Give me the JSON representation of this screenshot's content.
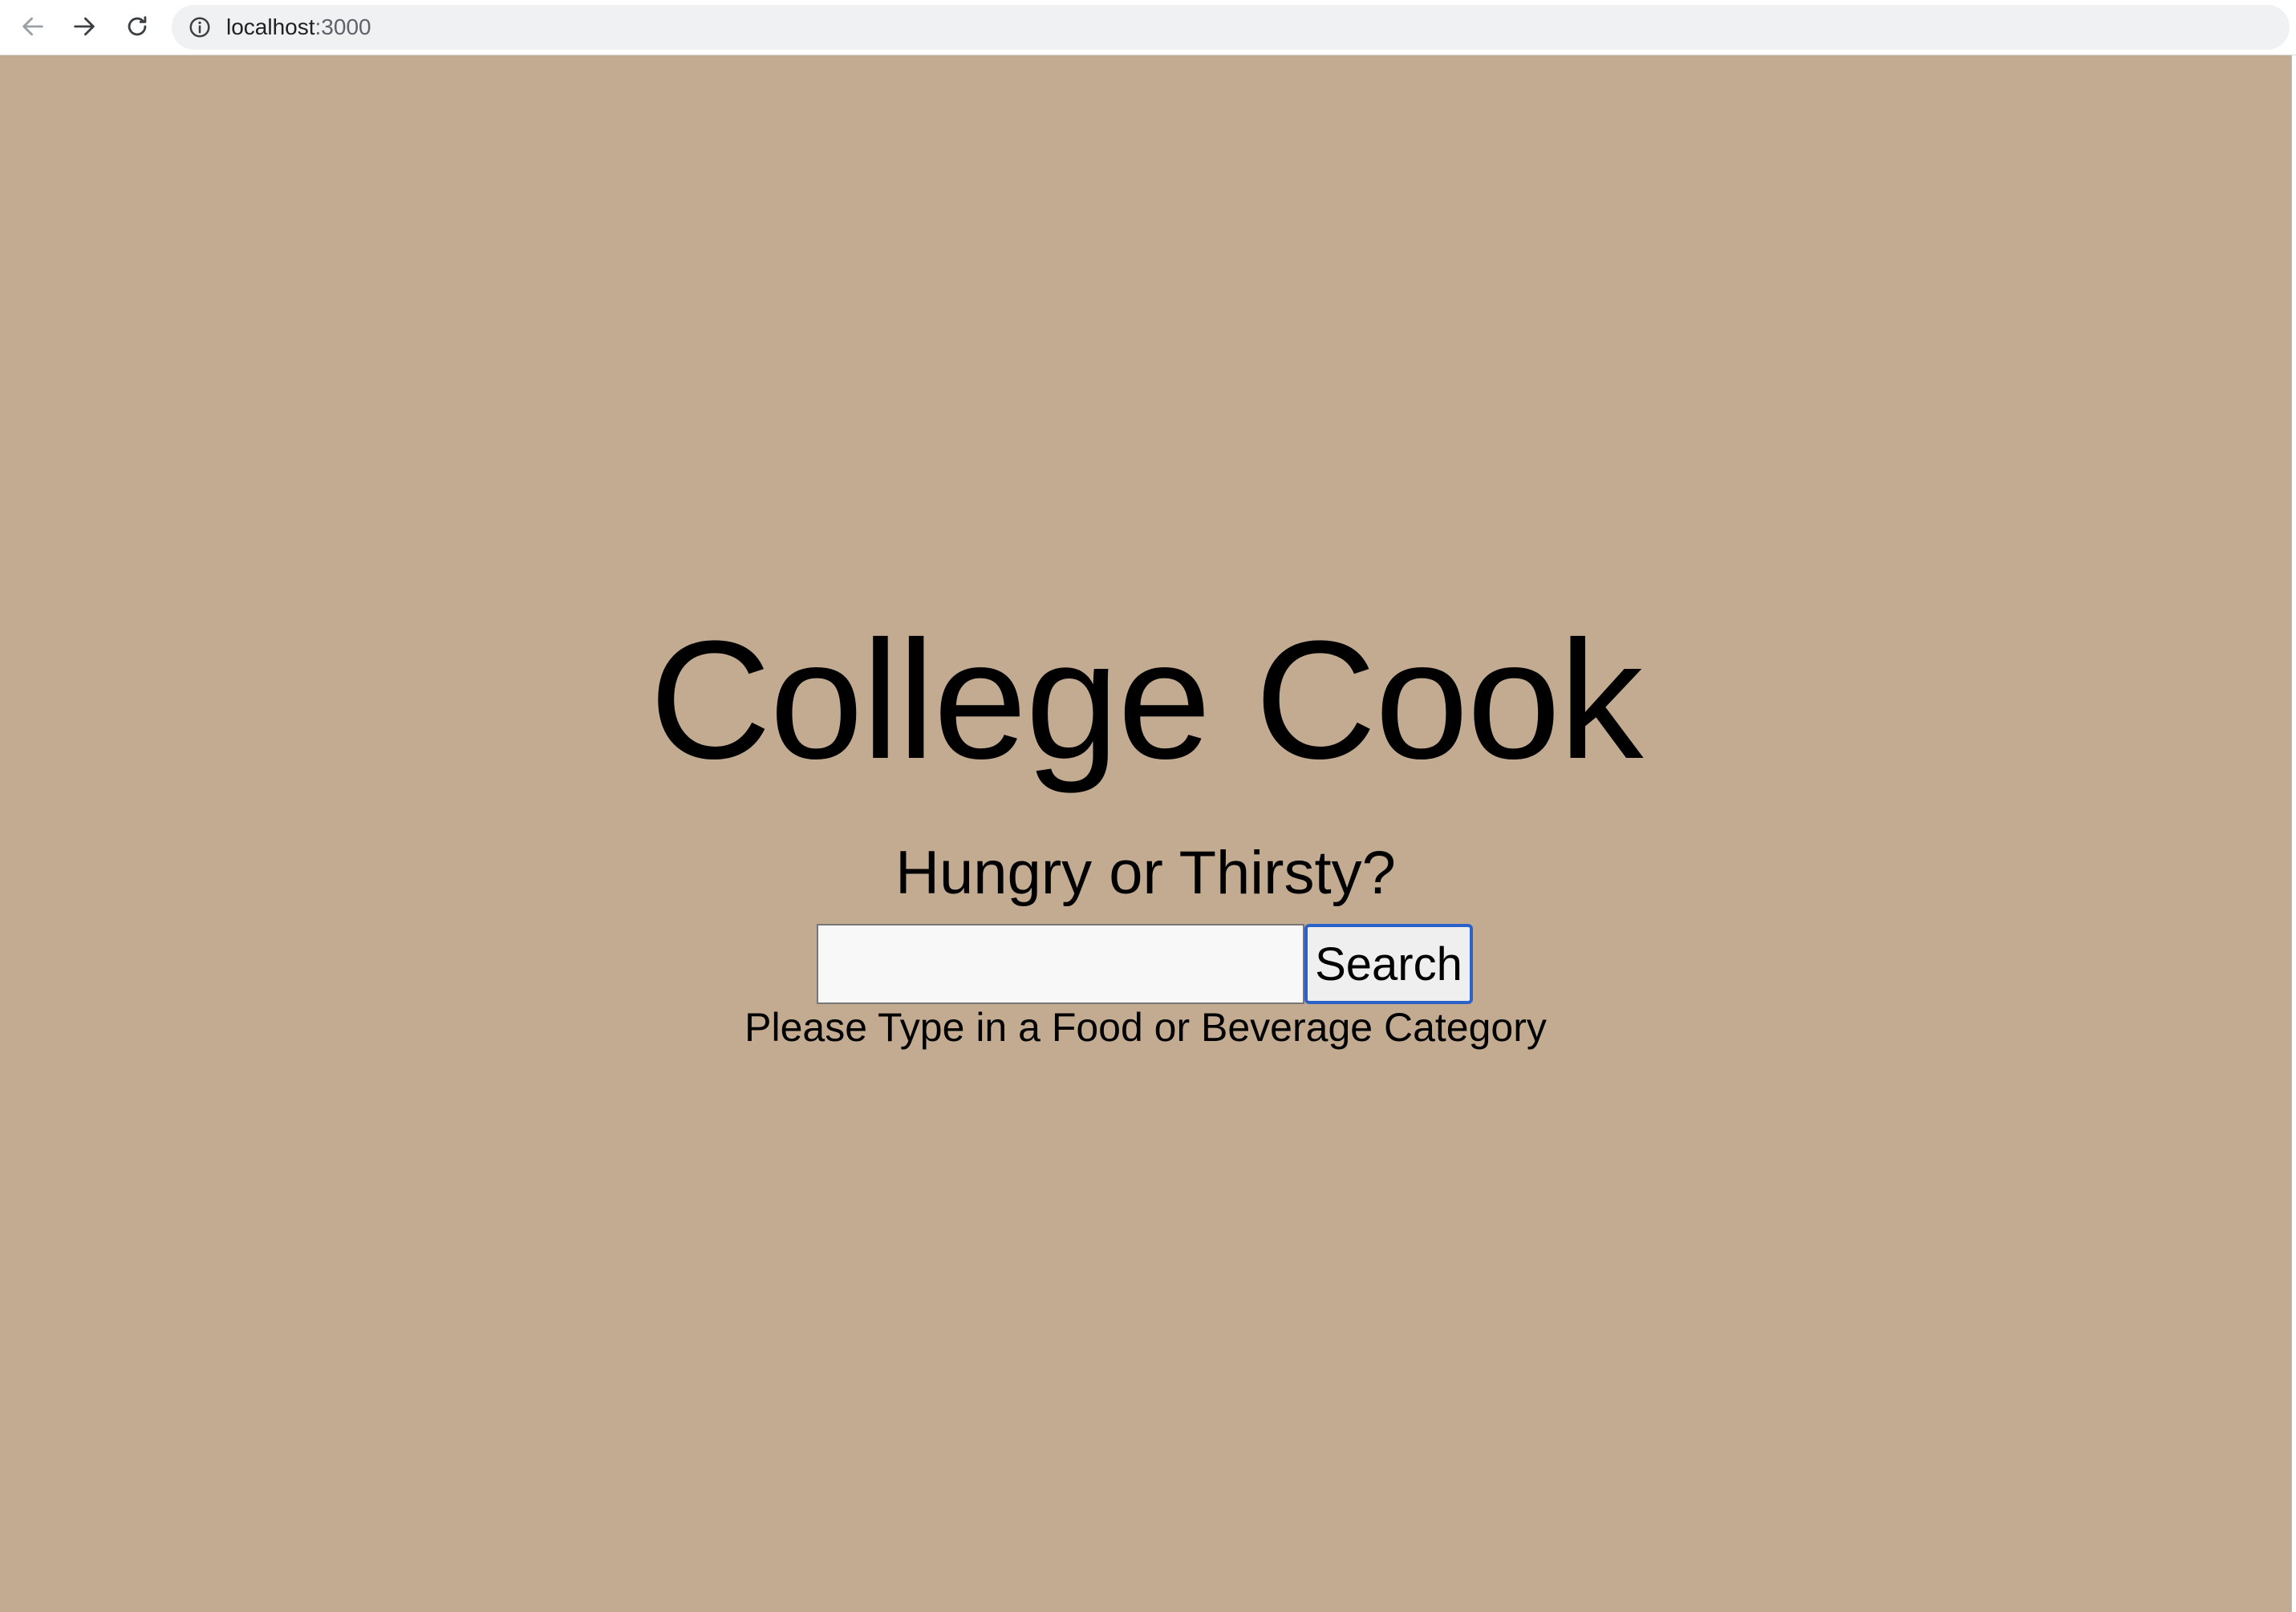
{
  "browser": {
    "url_host": "localhost",
    "url_port": ":3000",
    "icons": {
      "back": "arrow-left-icon",
      "forward": "arrow-right-icon",
      "reload": "reload-icon",
      "info": "info-icon"
    }
  },
  "main": {
    "title": "College Cook",
    "subtitle": "Hungry or Thirsty?",
    "search": {
      "value": "",
      "placeholder": "",
      "button_label": "Search"
    },
    "hint": "Please Type in a Food or Beverage Category"
  },
  "colors": {
    "page_background": "#c3ab91",
    "button_focus_border": "#2b62c9"
  }
}
